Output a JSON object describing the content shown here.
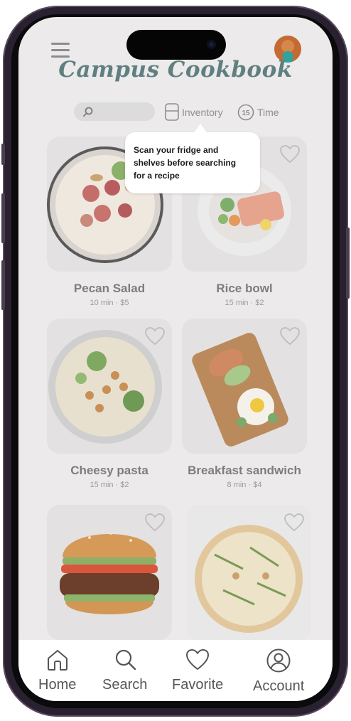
{
  "app": {
    "title": "Campus Cookbook"
  },
  "header": {
    "menu_icon": "hamburger-menu-icon",
    "avatar_icon": "user-avatar"
  },
  "search": {
    "placeholder": "",
    "icon": "search-icon"
  },
  "filters": [
    {
      "label": "Inventory",
      "icon": "fridge-icon"
    },
    {
      "label": "Time",
      "icon": "timer-icon",
      "badge": "15"
    }
  ],
  "tooltip": {
    "text": "Scan your fridge and\nshelves before searching\nfor a recipe"
  },
  "recipes": [
    {
      "name": "Pecan Salad",
      "meta": "10 min · $5"
    },
    {
      "name": "Rice bowl",
      "meta": "15 min · $2"
    },
    {
      "name": "Cheesy pasta",
      "meta": "15 min · $2"
    },
    {
      "name": "Breakfast sandwich",
      "meta": "8 min · $4"
    },
    {
      "name": "",
      "meta": ""
    },
    {
      "name": "",
      "meta": ""
    }
  ],
  "tabbar": [
    {
      "label": "Home",
      "icon": "home-icon"
    },
    {
      "label": "Search",
      "icon": "search-icon"
    },
    {
      "label": "Favorite",
      "icon": "heart-icon"
    },
    {
      "label": "Account",
      "icon": "account-icon"
    }
  ],
  "colors": {
    "accent": "#5f7f80",
    "overlay": "#eceaea",
    "text_muted": "#7d7d7d",
    "tabbar_bg": "#ffffff"
  }
}
